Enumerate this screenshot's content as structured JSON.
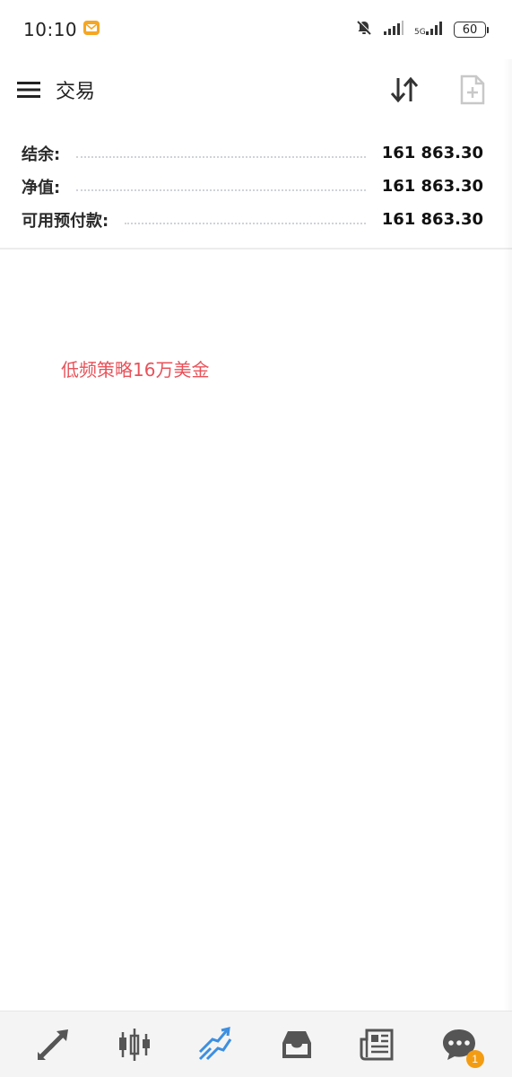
{
  "status_bar": {
    "time": "10:10",
    "battery": "60"
  },
  "app_bar": {
    "title": "交易"
  },
  "account_summary": {
    "rows": [
      {
        "label": "结余:",
        "value": "161 863.30"
      },
      {
        "label": "净值:",
        "value": "161 863.30"
      },
      {
        "label": "可用预付款:",
        "value": "161 863.30"
      }
    ]
  },
  "watermark_text": "低频策略16万美金",
  "bottom_nav": {
    "items": [
      {
        "icon": "quotes-arrows-icon"
      },
      {
        "icon": "candlestick-chart-icon"
      },
      {
        "icon": "trade-trend-icon",
        "active": true
      },
      {
        "icon": "history-inbox-icon"
      },
      {
        "icon": "news-icon"
      },
      {
        "icon": "messages-chat-icon",
        "badge": "1"
      }
    ]
  },
  "colors": {
    "accent": "#3d8fe0",
    "badge": "#f39c12",
    "watermark": "#e8525a",
    "icon_default": "#555555"
  }
}
